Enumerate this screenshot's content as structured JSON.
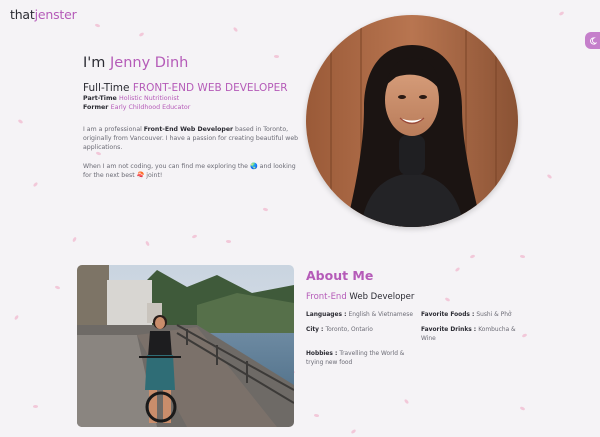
{
  "brand": {
    "prefix": "that",
    "accent": "jenster"
  },
  "theme_toggle": {
    "icon": "moon-icon"
  },
  "hero": {
    "greeting": "I'm ",
    "name": "Jenny Dinh",
    "role_main_prefix": "Full-Time ",
    "role_main_accent": "FRONT-END WEB DEVELOPER",
    "role_part_prefix": "Part-Time ",
    "role_part_accent": "Holistic Nutritionist",
    "role_former_prefix": "Former ",
    "role_former_accent": "Early Childhood Educator",
    "bio1_a": "I am a professional ",
    "bio1_b": "Front-End Web Developer",
    "bio1_c": " based in Toronto, originally from Vancouver. I have a passion for creating beautiful web applications.",
    "bio2_a": "When I am not coding, you can find me exploring the ",
    "bio2_globe": "🌏",
    "bio2_b": " and looking for the next best ",
    "bio2_sushi": "🍣",
    "bio2_c": " joint!"
  },
  "about": {
    "title": "About Me",
    "sub_accent": "Front-End",
    "sub_rest": " Web Developer",
    "facts": [
      {
        "key": "Languages : ",
        "value": "English & Vietnamese"
      },
      {
        "key": "Favorite Foods : ",
        "value": "Sushi & Phở"
      },
      {
        "key": "City : ",
        "value": "Toronto, Ontario"
      },
      {
        "key": "Favorite Drinks : ",
        "value": "Kombucha & Wine"
      },
      {
        "key": "Hobbies : ",
        "value": "Travelling the World & trying new food"
      }
    ]
  },
  "colors": {
    "accent": "#b55bb8",
    "background": "#f5f3f6",
    "petal": "#f0b9cf"
  }
}
